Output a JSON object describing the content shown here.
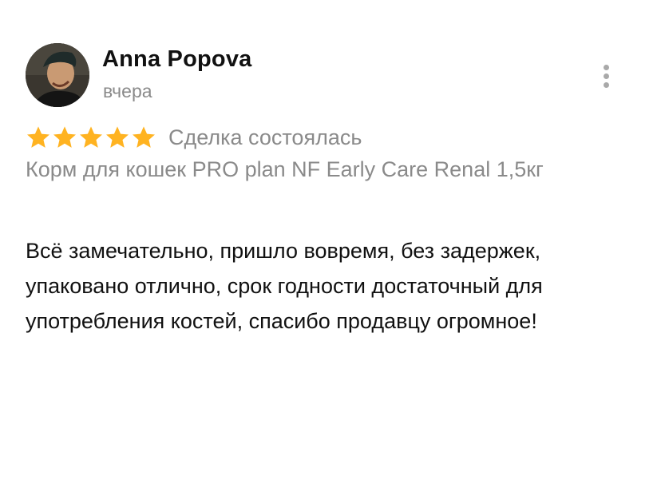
{
  "review": {
    "author_name": "Anna Popova",
    "date": "вчера",
    "rating": 5,
    "rating_max": 5,
    "star_color": "#ffb321",
    "deal_status": "Сделка состоялась",
    "product_title": "Корм для кошек PRO plan NF Early Care Renal 1,5кг",
    "text": "Всё замечательно, пришло вовремя, без задержек, упаковано отлично, срок годности достаточный для употребления костей, спасибо продавцу огромное!"
  },
  "icons": {
    "more": "more-vertical-icon",
    "star": "star-icon"
  }
}
